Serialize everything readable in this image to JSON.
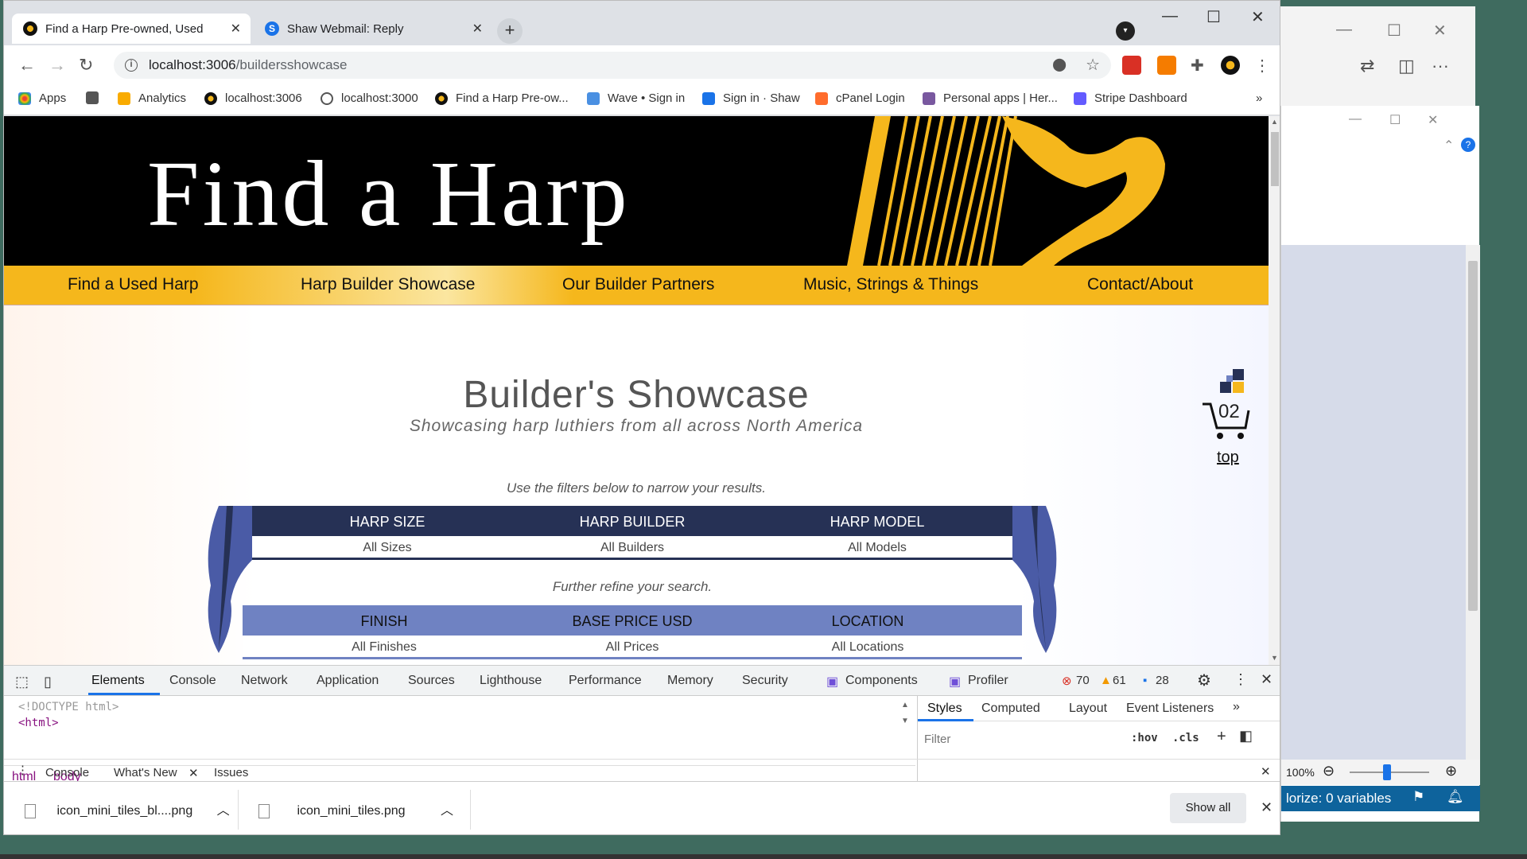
{
  "browser": {
    "tabs": [
      {
        "title": "Find a Harp Pre-owned, Used",
        "active": true
      },
      {
        "title": "Shaw Webmail: Reply",
        "active": false
      }
    ],
    "url_host": "localhost:3006",
    "url_path": "/buildersshowcase",
    "bookmarks": [
      "Apps",
      "Analytics",
      "localhost:3006",
      "localhost:3000",
      "Find a Harp Pre-ow...",
      "Wave • Sign in",
      "Sign in · Shaw",
      "cPanel Login",
      "Personal apps | Her...",
      "Stripe Dashboard"
    ]
  },
  "site": {
    "title": "Find a Harp",
    "nav": [
      "Find a Used Harp",
      "Harp Builder Showcase",
      "Our Builder Partners",
      "Music, Strings & Things",
      "Contact/About"
    ],
    "heading": "Builder's Showcase",
    "subheading": "Showcasing harp luthiers from all across North America",
    "filter_hint": "Use the filters below to narrow your results.",
    "refine_hint": "Further refine your search.",
    "filters_primary": [
      {
        "label": "HARP SIZE",
        "value": "All Sizes"
      },
      {
        "label": "HARP BUILDER",
        "value": "All Builders"
      },
      {
        "label": "HARP MODEL",
        "value": "All Models"
      }
    ],
    "filters_secondary": [
      {
        "label": "FINISH",
        "value": "All Finishes"
      },
      {
        "label": "BASE PRICE USD",
        "value": "All Prices"
      },
      {
        "label": "LOCATION",
        "value": "All Locations"
      }
    ],
    "cart_count": "02",
    "top_link": "top"
  },
  "devtools": {
    "tabs": [
      "Elements",
      "Console",
      "Network",
      "Application",
      "Sources",
      "Lighthouse",
      "Performance",
      "Memory",
      "Security",
      "Components",
      "Profiler"
    ],
    "errors": "70",
    "warnings": "61",
    "messages": "28",
    "code_lines": [
      "<!DOCTYPE html>",
      "<html>"
    ],
    "breadcrumbs": [
      "html",
      "body"
    ],
    "styles_tabs": [
      "Styles",
      "Computed",
      "Layout",
      "Event Listeners"
    ],
    "filter_placeholder": "Filter",
    "hov": ":hov",
    "cls": ".cls",
    "drawer_tabs": [
      "Console",
      "What's New",
      "Issues"
    ]
  },
  "downloads": {
    "items": [
      "icon_mini_tiles_bl....png",
      "icon_mini_tiles.png"
    ],
    "show_all": "Show all"
  },
  "side_window": {
    "zoom": "100%",
    "status": "lorize: 0 variables"
  }
}
